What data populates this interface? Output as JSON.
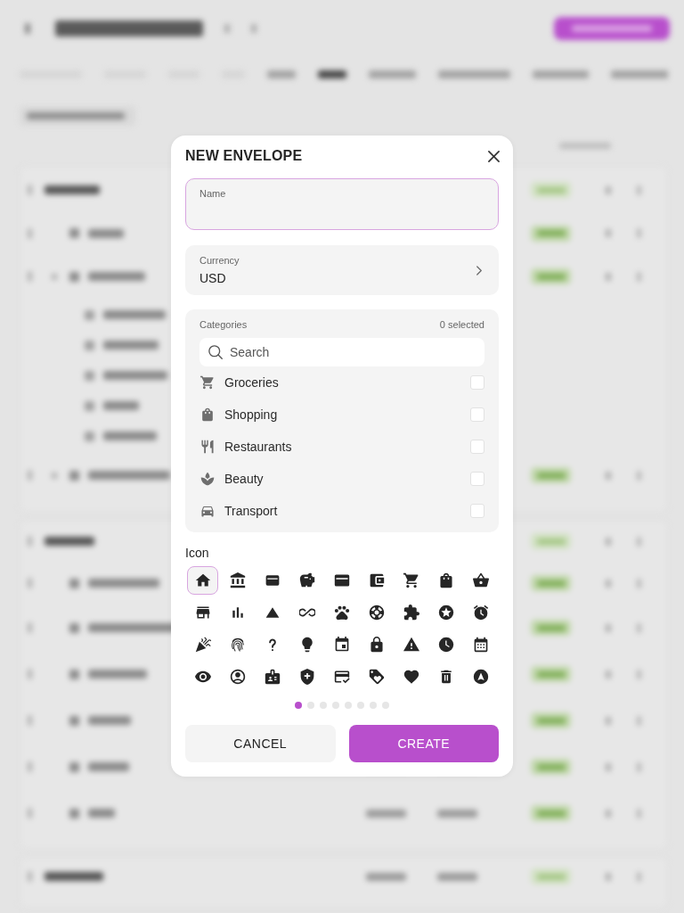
{
  "dialog": {
    "title": "NEW ENVELOPE",
    "name_field": {
      "label": "Name",
      "focused": true
    },
    "currency_field": {
      "label": "Currency",
      "value": "USD"
    },
    "categories": {
      "label": "Categories",
      "selected_count": "0 selected",
      "search": {
        "placeholder": "Search"
      },
      "items": [
        {
          "label": "Groceries",
          "checked": false
        },
        {
          "label": "Shopping",
          "checked": false
        },
        {
          "label": "Restaurants",
          "checked": false
        },
        {
          "label": "Beauty",
          "checked": false
        },
        {
          "label": "Transport",
          "checked": false
        }
      ]
    },
    "icon_picker": {
      "label": "Icon",
      "icons": [
        {
          "selected": true
        },
        {
          "selected": false
        },
        {
          "selected": false
        },
        {
          "selected": false
        },
        {
          "selected": false
        },
        {
          "selected": false
        },
        {
          "selected": false
        },
        {
          "selected": false
        },
        {
          "selected": false
        },
        {
          "selected": false
        },
        {
          "selected": false
        },
        {
          "selected": false
        },
        {
          "selected": false
        },
        {
          "selected": false
        },
        {
          "selected": false
        },
        {
          "selected": false
        },
        {
          "selected": false
        },
        {
          "selected": false
        },
        {
          "selected": false
        },
        {
          "selected": false
        },
        {
          "selected": false
        },
        {
          "selected": false
        },
        {
          "selected": false
        },
        {
          "selected": false
        },
        {
          "selected": false
        },
        {
          "selected": false
        },
        {
          "selected": false
        },
        {
          "selected": false
        },
        {
          "selected": false
        },
        {
          "selected": false
        },
        {
          "selected": false
        },
        {
          "selected": false
        },
        {
          "selected": false
        },
        {
          "selected": false
        },
        {
          "selected": false
        },
        {
          "selected": false
        }
      ],
      "pages": [
        {
          "selected": true
        },
        {
          "selected": false
        },
        {
          "selected": false
        },
        {
          "selected": false
        },
        {
          "selected": false
        },
        {
          "selected": false
        },
        {
          "selected": false
        },
        {
          "selected": false
        }
      ]
    },
    "buttons": [
      {
        "label": "CANCEL",
        "kind": "secondary"
      },
      {
        "label": "CREATE",
        "kind": "primary"
      }
    ]
  }
}
